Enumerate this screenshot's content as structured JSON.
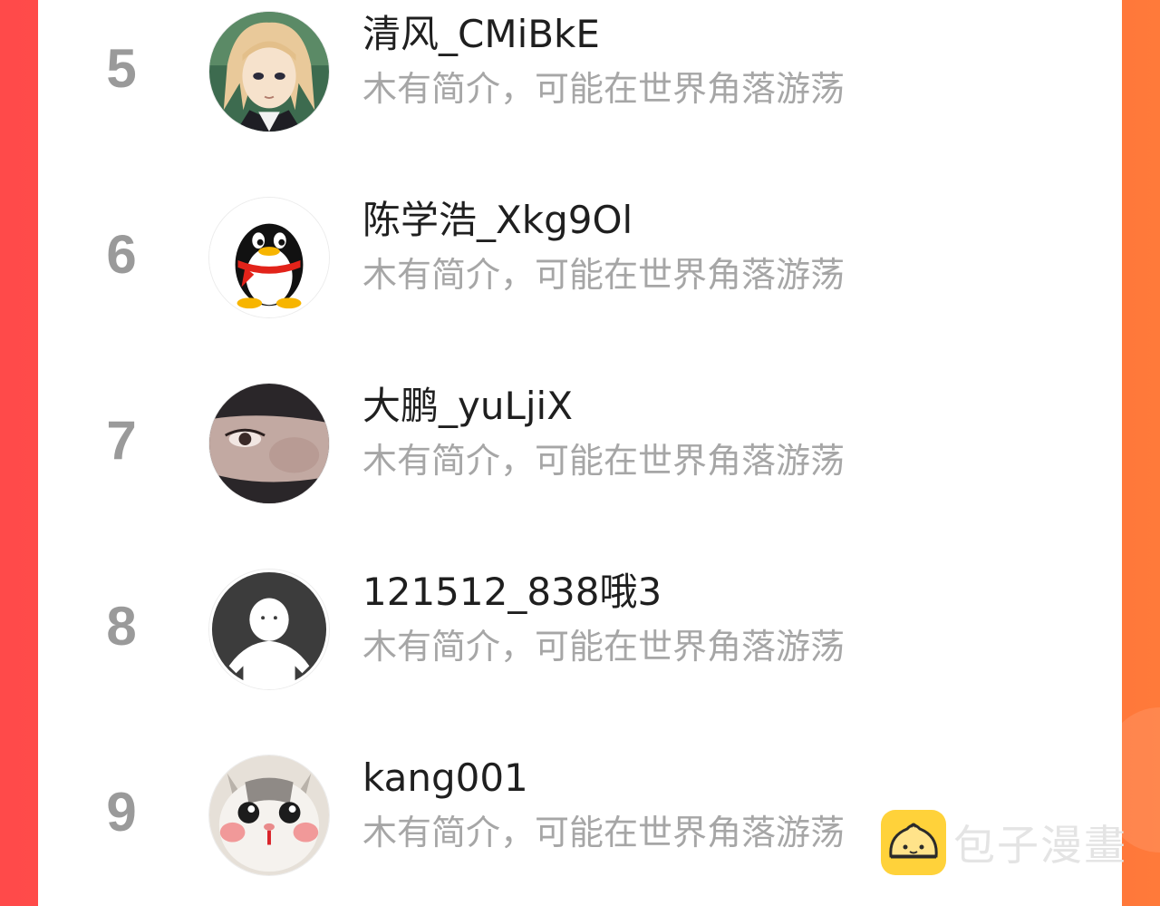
{
  "rankings": [
    {
      "rank": "5",
      "name": "清风_CMiBkE",
      "bio": "木有简介，可能在世界角落游荡",
      "avatar_icon": "anime-character-avatar"
    },
    {
      "rank": "6",
      "name": "陈学浩_Xkg9Ol",
      "bio": "木有简介，可能在世界角落游荡",
      "avatar_icon": "qq-penguin-avatar"
    },
    {
      "rank": "7",
      "name": "大鹏_yuLjiX",
      "bio": "木有简介，可能在世界角落游荡",
      "avatar_icon": "eye-photo-avatar"
    },
    {
      "rank": "8",
      "name": "121512_838哦3",
      "bio": "木有简介，可能在世界角落游荡",
      "avatar_icon": "default-person-avatar"
    },
    {
      "rank": "9",
      "name": "kang001",
      "bio": "木有简介，可能在世界角落游荡",
      "avatar_icon": "cat-avatar"
    }
  ],
  "watermark": {
    "text": "包子漫畫",
    "logo_icon": "bun-logo-icon"
  },
  "colors": {
    "background_left": "#ff4a4a",
    "background_right": "#ff7a3a",
    "panel": "#ffffff",
    "rank_text": "#9a9a9a",
    "name_text": "#1f1f1f",
    "bio_text": "#a6a6a6",
    "watermark_logo": "#ffd23a"
  }
}
